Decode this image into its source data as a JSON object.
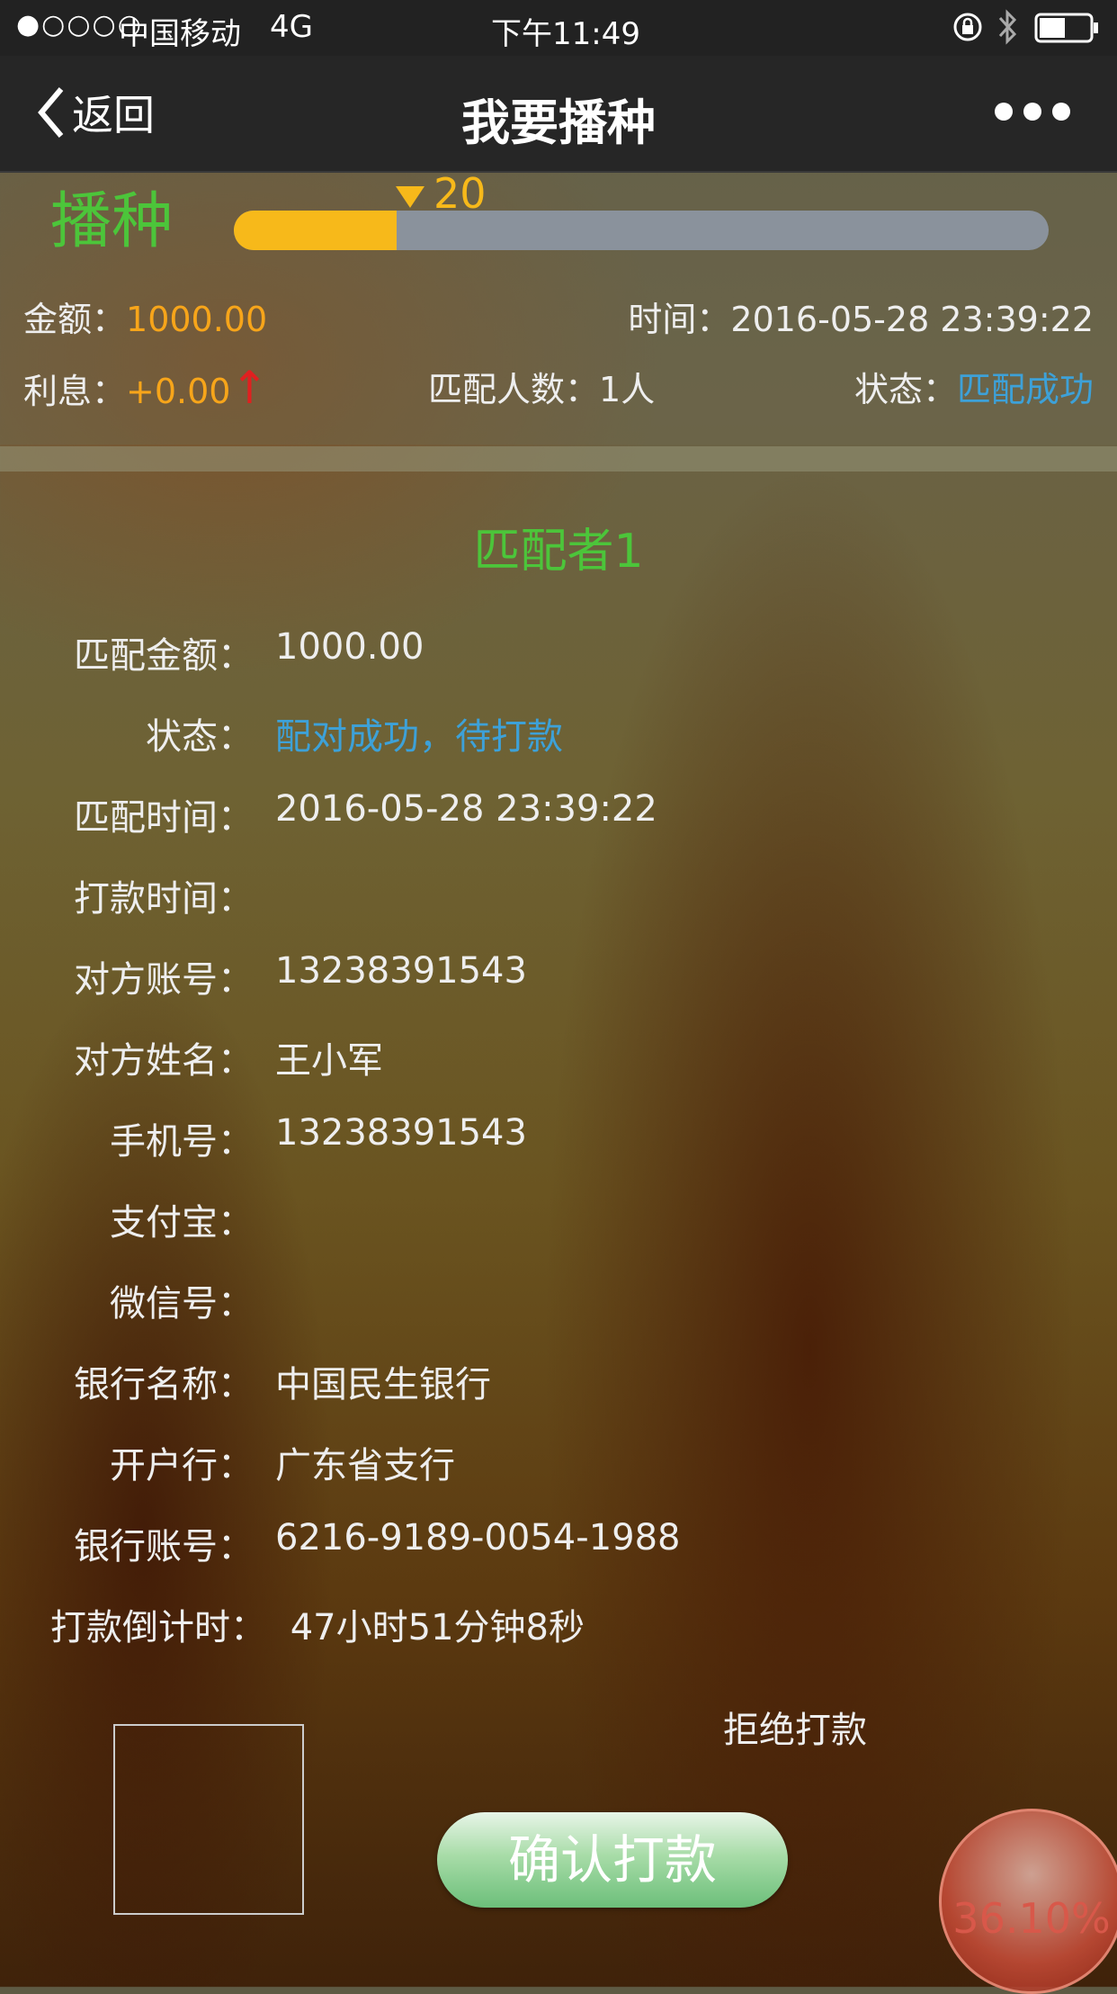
{
  "status_bar": {
    "signal": "●○○○○",
    "carrier": "中国移动",
    "network": "4G",
    "time": "下午11:49"
  },
  "nav": {
    "back_label": "返回",
    "title": "我要播种"
  },
  "sowing": {
    "title": "播种",
    "progress_label": "20",
    "progress_fraction": 0.2,
    "amount_label": "金额：",
    "amount": "1000.00",
    "time_label": "时间：",
    "time": "2016-05-28 23:39:22",
    "interest_label": "利息：",
    "interest": "+0.00",
    "interest_arrow": "↑",
    "match_count_label": "匹配人数：",
    "match_count": "1人",
    "status_label": "状态：",
    "status": "匹配成功"
  },
  "matcher": {
    "title": "匹配者1",
    "fields": [
      {
        "label": "匹配金额：",
        "value": "1000.00"
      },
      {
        "label": "状态：",
        "value": "配对成功，待打款"
      },
      {
        "label": "匹配时间：",
        "value": "2016-05-28 23:39:22"
      },
      {
        "label": "打款时间：",
        "value": ""
      },
      {
        "label": "对方账号：",
        "value": "13238391543"
      },
      {
        "label": "对方姓名：",
        "value": "王小军"
      },
      {
        "label": "手机号：",
        "value": "13238391543"
      },
      {
        "label": "支付宝：",
        "value": ""
      },
      {
        "label": "微信号：",
        "value": ""
      },
      {
        "label": "银行名称：",
        "value": "中国民生银行"
      },
      {
        "label": "开户行：",
        "value": "广东省支行"
      },
      {
        "label": "银行账号：",
        "value": "6216-9189-0054-1988"
      }
    ],
    "countdown_label": "打款倒计时：",
    "countdown": "47小时51分钟8秒"
  },
  "actions": {
    "refuse_label": "拒绝打款",
    "confirm_label": "确认打款"
  },
  "floating_ball": {
    "percent": "36.10%"
  },
  "colors": {
    "green": "#4cc53a",
    "orange": "#f7a51a",
    "blue": "#3da1d8",
    "progress_fill": "#f7b91a"
  }
}
